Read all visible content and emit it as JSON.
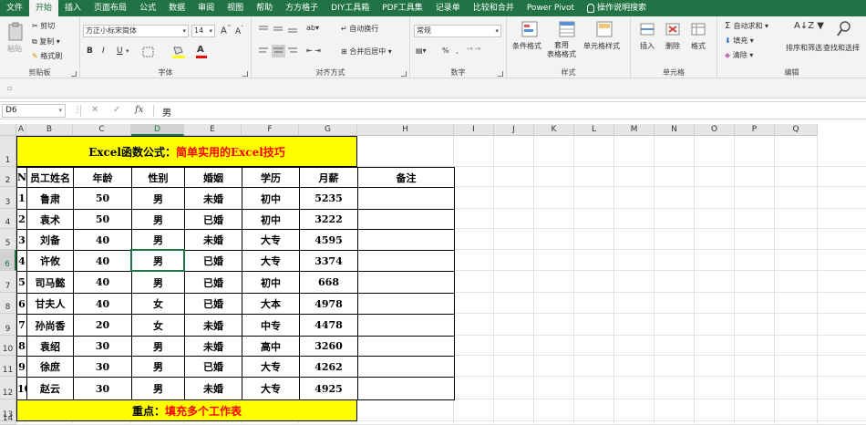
{
  "ribbon_tabs": [
    "文件",
    "开始",
    "插入",
    "页面布局",
    "公式",
    "数据",
    "审阅",
    "视图",
    "帮助",
    "方方格子",
    "DIY工具箱",
    "PDF工具集",
    "记录单",
    "比较和合并",
    "Power Pivot"
  ],
  "active_tab": "开始",
  "tell_me": "操作说明搜索",
  "clipboard": {
    "paste": "粘贴",
    "cut": "剪切",
    "copy": "复制",
    "format_painter": "格式刷",
    "label": "剪贴板"
  },
  "font": {
    "name": "方正小标宋简体",
    "size": "14",
    "label": "字体",
    "bold": "B",
    "italic": "I",
    "underline": "U",
    "grow": "A",
    "shrink": "A"
  },
  "alignment": {
    "wrap": "自动换行",
    "merge": "合并后居中",
    "label": "对齐方式"
  },
  "number": {
    "format": "常规",
    "percent": "%",
    "comma": ",",
    "label": "数字"
  },
  "styles": {
    "conditional": "条件格式",
    "table": "套用\n表格格式",
    "cell_styles": "单元格样式",
    "label": "样式"
  },
  "cells": {
    "insert": "插入",
    "delete": "删除",
    "format": "格式",
    "label": "单元格"
  },
  "editing": {
    "autosum": "自动求和",
    "fill": "填充",
    "clear": "清除",
    "sort": "排序和筛选",
    "find": "查找和选择",
    "label": "编辑"
  },
  "name_box": "D6",
  "formula_fx": "fx",
  "formula_value": "男",
  "columns": [
    "A",
    "B",
    "C",
    "D",
    "E",
    "F",
    "G",
    "H",
    "I",
    "J",
    "K",
    "L",
    "M",
    "N",
    "O",
    "P",
    "Q"
  ],
  "rows": [
    "1",
    "2",
    "3",
    "4",
    "5",
    "6",
    "7",
    "8",
    "9",
    "10",
    "11",
    "12",
    "13",
    "14"
  ],
  "selected_cell": {
    "col": "D",
    "row": "6"
  },
  "title": {
    "prefix": "Excel函数公式：",
    "highlight": "简单实用的Excel技巧"
  },
  "headers": [
    "No",
    "员工姓名",
    "年龄",
    "性别",
    "婚姻",
    "学历",
    "月薪",
    "备注"
  ],
  "records": [
    [
      "1",
      "鲁肃",
      "50",
      "男",
      "未婚",
      "初中",
      "5235",
      ""
    ],
    [
      "2",
      "袁术",
      "50",
      "男",
      "已婚",
      "初中",
      "3222",
      ""
    ],
    [
      "3",
      "刘备",
      "40",
      "男",
      "未婚",
      "大专",
      "4595",
      ""
    ],
    [
      "4",
      "许攸",
      "40",
      "男",
      "已婚",
      "大专",
      "3374",
      ""
    ],
    [
      "5",
      "司马懿",
      "40",
      "男",
      "已婚",
      "初中",
      "668",
      ""
    ],
    [
      "6",
      "甘夫人",
      "40",
      "女",
      "已婚",
      "大本",
      "4978",
      ""
    ],
    [
      "7",
      "孙尚香",
      "20",
      "女",
      "未婚",
      "中专",
      "4478",
      ""
    ],
    [
      "8",
      "袁绍",
      "30",
      "男",
      "未婚",
      "高中",
      "3260",
      ""
    ],
    [
      "9",
      "徐庶",
      "30",
      "男",
      "已婚",
      "大专",
      "4262",
      ""
    ],
    [
      "10",
      "赵云",
      "30",
      "男",
      "未婚",
      "大专",
      "4925",
      ""
    ]
  ],
  "footer": {
    "prefix": "重点：",
    "highlight": "填充多个工作表"
  },
  "colors": {
    "excel_green": "#217346",
    "banner_yellow": "#ffff00",
    "highlight_red": "#ff0000"
  }
}
